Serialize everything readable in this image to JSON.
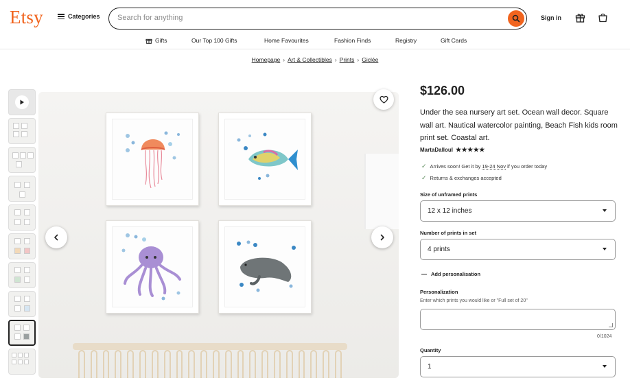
{
  "header": {
    "logo": "Etsy",
    "categories_label": "Categories",
    "search_placeholder": "Search for anything",
    "signin_label": "Sign in"
  },
  "nav": {
    "items": [
      "Gifts",
      "Our Top 100 Gifts",
      "Home Favourites",
      "Fashion Finds",
      "Registry",
      "Gift Cards"
    ]
  },
  "breadcrumb": [
    "Homepage",
    "Art & Collectibles",
    "Prints",
    "Giclée"
  ],
  "gallery": {
    "thumbnail_count": 10,
    "active_thumbnail_index": 8
  },
  "product": {
    "price": "$126.00",
    "title": "Under the sea nursery art set. Ocean wall decor. Square wall art. Nautical watercolor painting, Beach Fish kids room print set. Coastal art.",
    "seller": "MartaDalloul",
    "stars": "★★★★★",
    "perks": {
      "arrival_prefix": "Arrives soon! Get it by ",
      "arrival_dates": "19-24 Nov",
      "arrival_suffix": " if you order today",
      "returns": "Returns & exchanges accepted"
    }
  },
  "options": {
    "size_label": "Size of unframed prints",
    "size_value": "12 x 12 inches",
    "count_label": "Number of prints in set",
    "count_value": "4 prints",
    "add_personalisation": "Add personalisation",
    "personalization_label": "Personalization",
    "personalization_help": "Enter which prints you would like or \"Full set of 20\"",
    "personalization_value": "",
    "personalization_counter": "0/1024",
    "quantity_label": "Quantity",
    "quantity_value": "1"
  },
  "colors": {
    "brand": "#F1641E"
  }
}
